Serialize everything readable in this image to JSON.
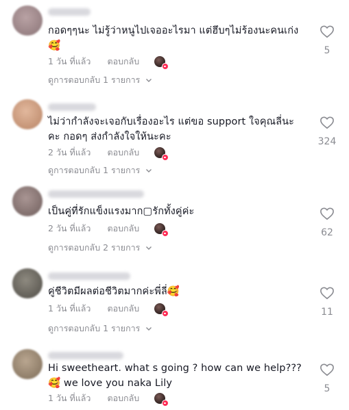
{
  "comments": [
    {
      "text": "กอดๆๆนะ ไม่รู้ว่าหนูไปเจออะไรมา แต่ฮึบๆไม่ร้องนะคนเก่ง\n🥰",
      "time": "1 วัน ที่แล้ว",
      "reply_label": "ตอบกลับ",
      "view_replies": "ดูการตอบกลับ 1 รายการ",
      "likes": "5",
      "avatar_color": "#a08a8c"
    },
    {
      "text": "ไม่ว่ากำลังจะเจอกับเรื่องอะไร แต่ขอ support ใจคุณลี่นะ\nคะ กอดๆ ส่งกำลังใจให้นะคะ",
      "time": "2 วัน ที่แล้ว",
      "reply_label": "ตอบกลับ",
      "view_replies": "ดูการตอบกลับ 1 รายการ",
      "likes": "324",
      "avatar_color": "#c79a7e"
    },
    {
      "text": "เป็นคู่ที่รักแข็งแรงมาก▢รักทั้งคู่ค่ะ",
      "time": "2 วัน ที่แล้ว",
      "reply_label": "ตอบกลับ",
      "view_replies": "ดูการตอบกลับ 2 รายการ",
      "likes": "62",
      "avatar_color": "#8d7a78"
    },
    {
      "text": "คู่ชีวิตมีผลต่อชีวิตมากค่ะพี่ลี่🥰",
      "time": "1 วัน ที่แล้ว",
      "reply_label": "ตอบกลับ",
      "view_replies": "ดูการตอบกลับ 1 รายการ",
      "likes": "11",
      "avatar_color": "#6f6a63"
    },
    {
      "text": "Hi sweetheart. what s going ? how can we help???\n🥰 we love you naka Lily",
      "time": "1 วัน ที่แล้ว",
      "reply_label": "ตอบกลับ",
      "view_replies": "",
      "likes": "5",
      "avatar_color": "#9c8a75"
    }
  ],
  "icons": {
    "like": "heart-outline-icon",
    "expand": "chevron-down-icon"
  },
  "colors": {
    "text": "#161823",
    "muted": "#8a8b91",
    "badge": "#fe2c55"
  }
}
